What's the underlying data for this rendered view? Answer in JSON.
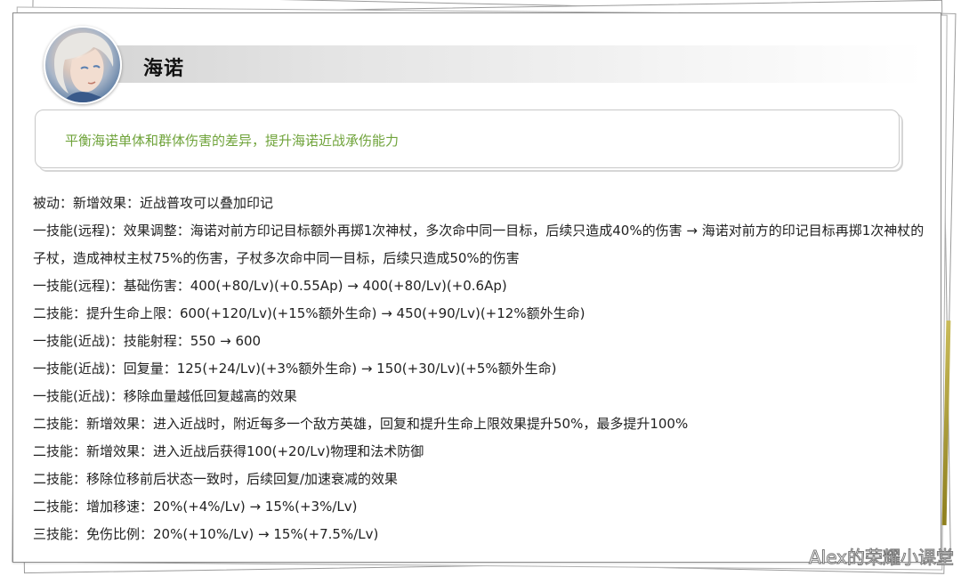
{
  "hero": {
    "name": "海诺"
  },
  "summary": "平衡海诺单体和群体伤害的差异，提升海诺近战承伤能力",
  "changes": [
    "被动：新增效果：近战普攻可以叠加印记",
    "一技能(远程)：效果调整：海诺对前方印记目标额外再掷1次神杖，多次命中同一目标，后续只造成40%的伤害 → 海诺对前方的印记目标再掷1次神杖的子杖，造成神杖主杖75%的伤害，子杖多次命中同一目标，后续只造成50%的伤害",
    "一技能(远程)：基础伤害：400(+80/Lv)(+0.55Ap) → 400(+80/Lv)(+0.6Ap)",
    "二技能：提升生命上限：600(+120/Lv)(+15%额外生命) → 450(+90/Lv)(+12%额外生命)",
    "一技能(近战)：技能射程：550 → 600",
    "一技能(近战)：回复量：125(+24/Lv)(+3%额外生命) → 150(+30/Lv)(+5%额外生命)",
    "一技能(近战)：移除血量越低回复越高的效果",
    "二技能：新增效果：进入近战时，附近每多一个敌方英雄，回复和提升生命上限效果提升50%，最多提升100%",
    "二技能：新增效果：进入近战后获得100(+20/Lv)物理和法术防御",
    "二技能：移除位移前后状态一致时，后续回复/加速衰减的效果",
    "二技能：增加移速：20%(+4%/Lv) → 15%(+3%/Lv)",
    "三技能：免伤比例：20%(+10%/Lv) → 15%(+7.5%/Lv)"
  ],
  "watermark": "Alex的荣耀小课堂",
  "colors": {
    "summary_text": "#6fa33a",
    "body_text": "#222222",
    "name_bar": "#d4d4d4"
  },
  "icons": {
    "avatar": "hero-portrait"
  }
}
